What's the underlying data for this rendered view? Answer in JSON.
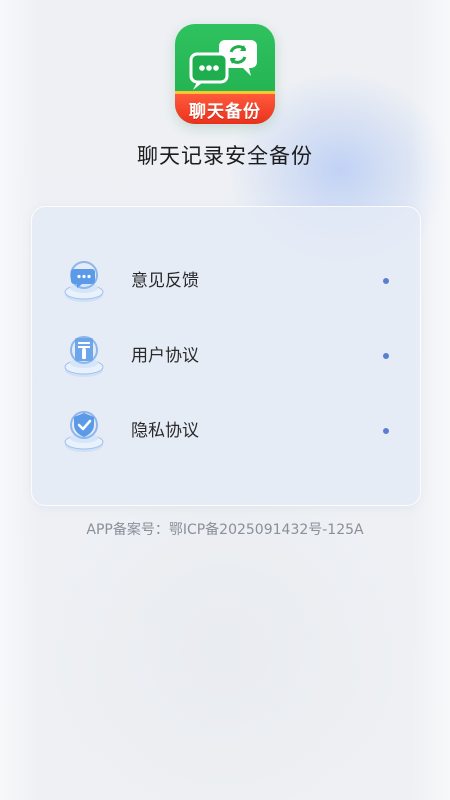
{
  "app": {
    "logo_text": "聊天备份",
    "title": "聊天记录安全备份"
  },
  "menu": {
    "items": [
      {
        "label": "意见反馈",
        "icon": "feedback-chat-icon"
      },
      {
        "label": "用户协议",
        "icon": "user-agreement-document-icon"
      },
      {
        "label": "隐私协议",
        "icon": "privacy-shield-icon"
      }
    ]
  },
  "footer": {
    "icp": "APP备案号：鄂ICP备2025091432号-125A"
  },
  "colors": {
    "logo_green": "#2fc25f",
    "logo_banner_red": "#e9321e",
    "logo_banner_border": "#ffc531",
    "accent_blue": "#5a7fd0",
    "title_text": "#1c1c1c",
    "footer_text": "#8a8f99"
  }
}
